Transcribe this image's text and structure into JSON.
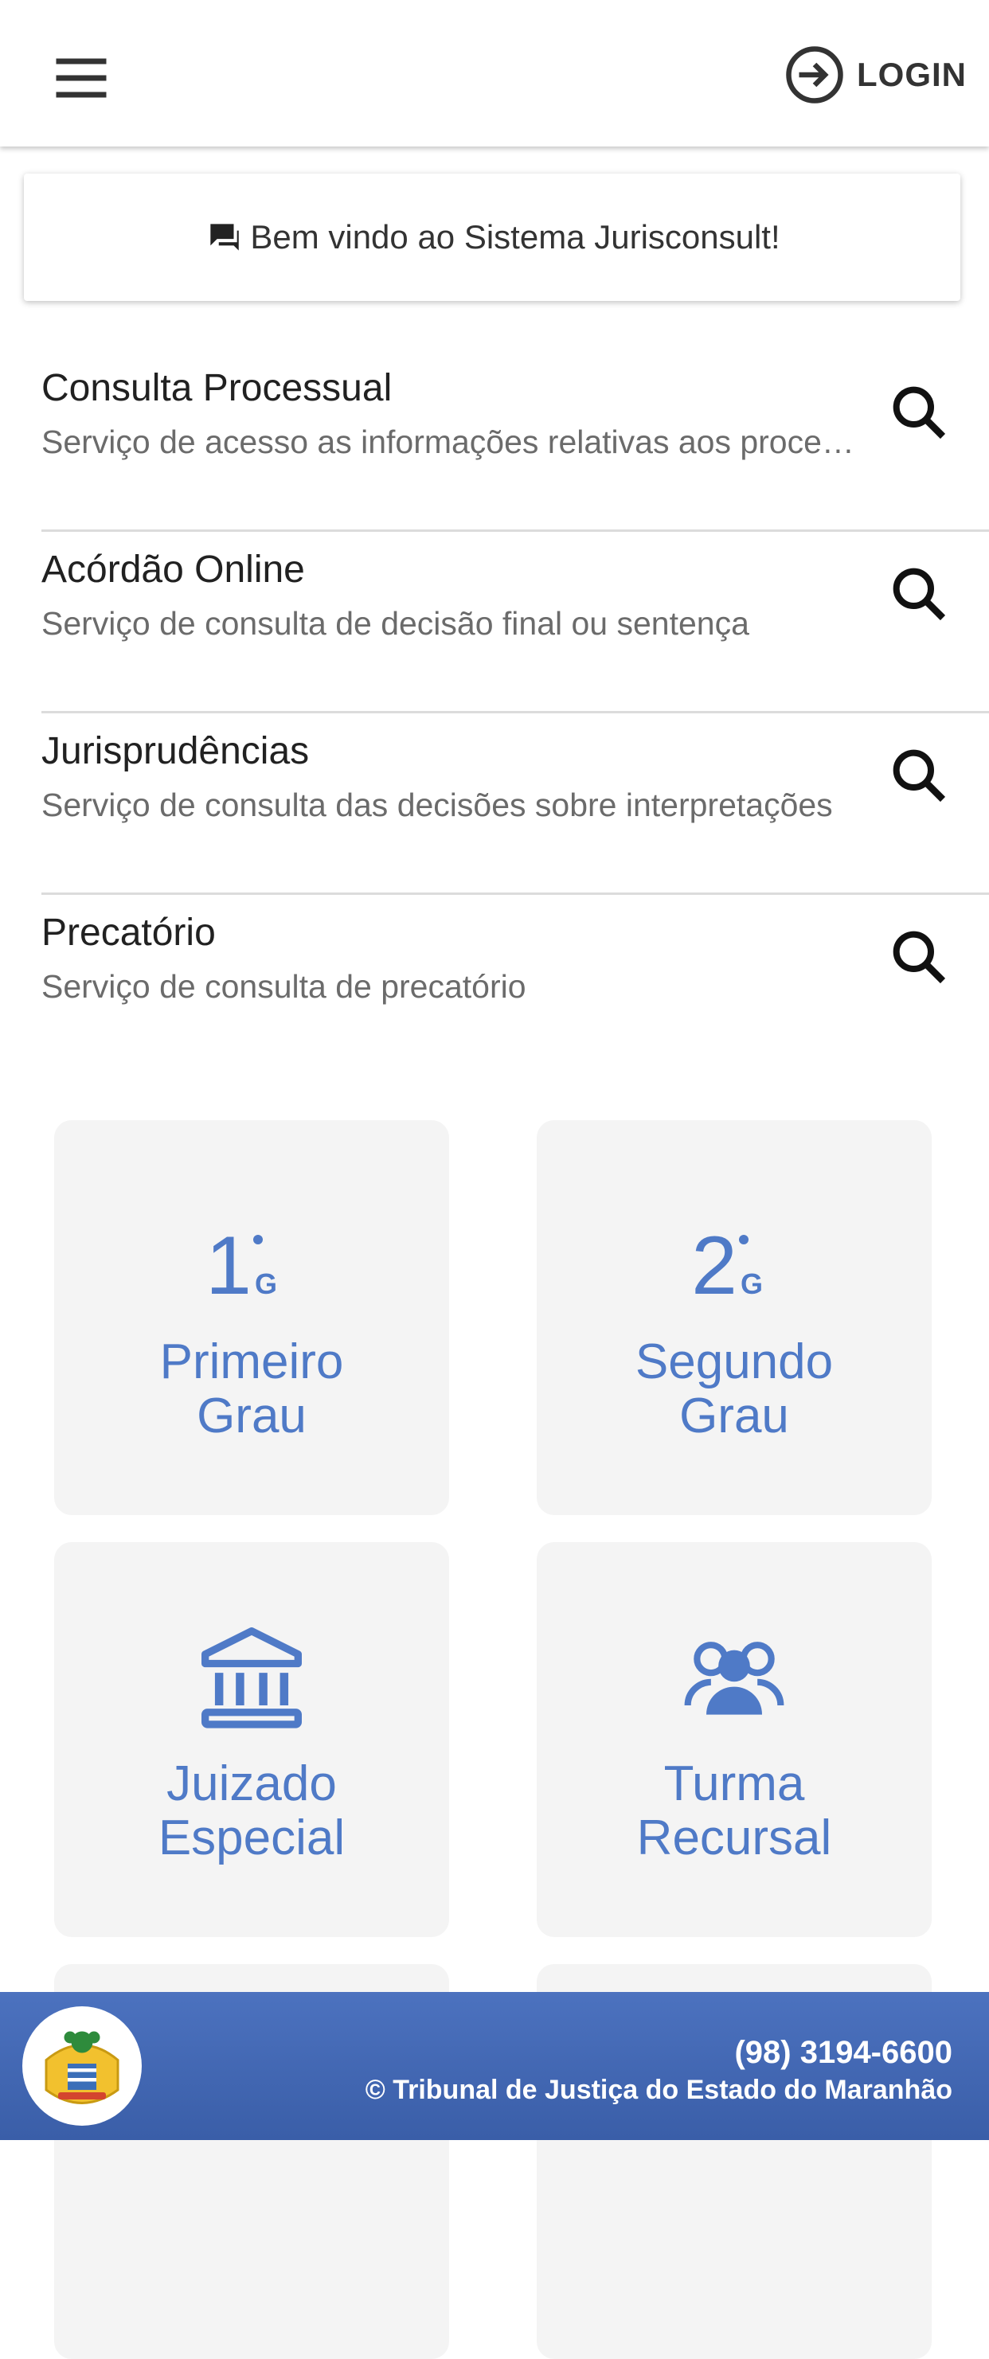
{
  "appbar": {
    "login_label": "LOGIN",
    "menu_icon": "menu-icon",
    "login_icon": "login-icon"
  },
  "welcome": {
    "text": "Bem vindo ao Sistema Jurisconsult!",
    "icon": "chat-icon"
  },
  "services": [
    {
      "title": "Consulta Processual",
      "description": "Serviço de acesso as informações relativas aos processos"
    },
    {
      "title": "Acórdão Online",
      "description": "Serviço de consulta de decisão final ou sentença"
    },
    {
      "title": "Jurisprudências",
      "description": "Serviço de consulta das decisões sobre interpretações"
    },
    {
      "title": "Precatório",
      "description": "Serviço de consulta de precatório"
    }
  ],
  "tiles": [
    {
      "number": "1",
      "suffix": "G",
      "line1": "Primeiro",
      "line2": "Grau"
    },
    {
      "number": "2",
      "suffix": "G",
      "line1": "Segundo",
      "line2": "Grau"
    },
    {
      "icon": "courthouse-icon",
      "line1": "Juizado",
      "line2": "Especial"
    },
    {
      "icon": "group-icon",
      "line1": "Turma",
      "line2": "Recursal"
    }
  ],
  "footer": {
    "phone": "(98) 3194-6600",
    "copyright": "© Tribunal de Justiça do Estado do Maranhão"
  },
  "colors": {
    "accent": "#4f7ac7",
    "footer": "#3f64b0",
    "tile_bg": "#f4f4f4"
  }
}
